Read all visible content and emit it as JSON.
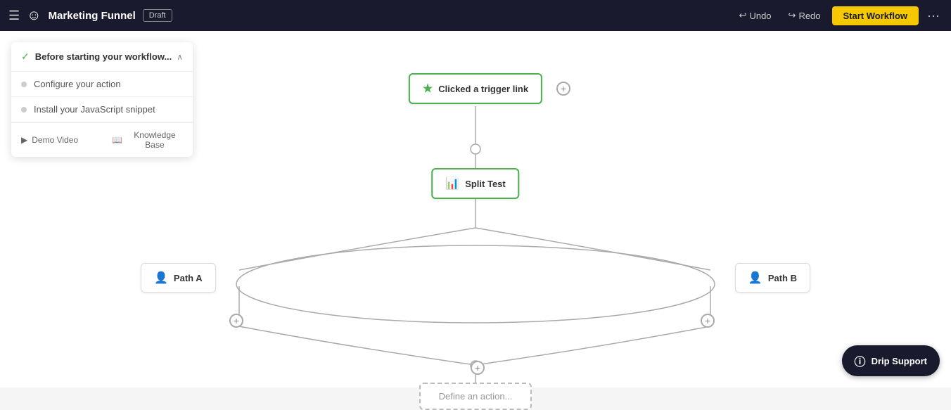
{
  "header": {
    "title": "Marketing Funnel",
    "draft_label": "Draft",
    "undo_label": "Undo",
    "redo_label": "Redo",
    "start_workflow_label": "Start Workflow",
    "hamburger_icon": "☰",
    "logo_icon": "☺",
    "more_icon": "···"
  },
  "sidebar": {
    "title": "Before starting your workflow...",
    "chevron_icon": "∧",
    "items": [
      {
        "label": "Configure your action"
      },
      {
        "label": "Install your JavaScript snippet"
      }
    ],
    "footer": [
      {
        "label": "Demo Video",
        "icon": "▶"
      },
      {
        "label": "Knowledge Base",
        "icon": "📖"
      }
    ]
  },
  "workflow": {
    "trigger": {
      "label": "Clicked a trigger link",
      "icon": "★"
    },
    "split_test": {
      "label": "Split Test",
      "icon": "📊"
    },
    "path_a": {
      "label": "Path A",
      "icon": "👤"
    },
    "path_b": {
      "label": "Path B",
      "icon": "👤"
    },
    "bottom": {
      "label": "Define an action..."
    }
  },
  "support": {
    "label": "Drip Support",
    "icon": "ⓘ"
  }
}
